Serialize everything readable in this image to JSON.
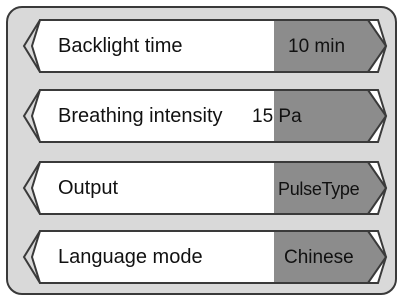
{
  "settings": {
    "items": [
      {
        "label": "Backlight time",
        "value": "10 min"
      },
      {
        "label": "Breathing intensity",
        "value": "15 Pa"
      },
      {
        "label": "Output",
        "value": "PulseType"
      },
      {
        "label": "Language mode",
        "value": "Chinese"
      }
    ]
  },
  "colors": {
    "panel_bg": "#d9d9d9",
    "item_bg": "#ffffff",
    "value_bg": "#8c8c8c",
    "border": "#3a3a3a"
  }
}
